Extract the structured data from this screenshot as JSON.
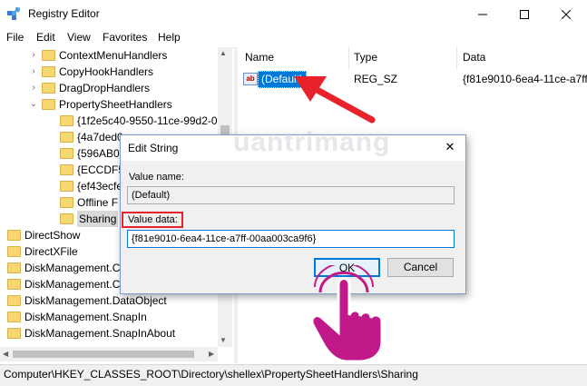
{
  "window": {
    "title": "Registry Editor",
    "minimize": "—",
    "maximize": "☐",
    "close": "✕"
  },
  "menu": [
    "File",
    "Edit",
    "View",
    "Favorites",
    "Help"
  ],
  "tree": {
    "items": [
      {
        "label": "ContextMenuHandlers",
        "expander": "›"
      },
      {
        "label": "CopyHookHandlers",
        "expander": "›"
      },
      {
        "label": "DragDropHandlers",
        "expander": "›"
      },
      {
        "label": "PropertySheetHandlers",
        "expander": "⌄"
      },
      {
        "label": "{1f2e5c40-9550-11ce-99d2-00"
      },
      {
        "label": "{4a7ded0"
      },
      {
        "label": "{596AB06"
      },
      {
        "label": "{ECCDF5"
      },
      {
        "label": "{ef43ecfe"
      },
      {
        "label": "Offline F"
      },
      {
        "label": "Sharing"
      },
      {
        "label": "DirectShow",
        "expander": "›"
      },
      {
        "label": "DirectXFile",
        "expander": "›"
      },
      {
        "label": "DiskManagement.C",
        "expander": "›"
      },
      {
        "label": "DiskManagement.C",
        "expander": "›"
      },
      {
        "label": "DiskManagement.DataObject",
        "expander": "›"
      },
      {
        "label": "DiskManagement.SnapIn",
        "expander": "›"
      },
      {
        "label": "DiskManagement.SnapInAbout",
        "expander": "›"
      }
    ]
  },
  "list": {
    "columns": [
      "Name",
      "Type",
      "Data"
    ],
    "rows": [
      {
        "icon": "ab",
        "name": "(Default)",
        "type": "REG_SZ",
        "data": "{f81e9010-6ea4-11ce-a7ff"
      }
    ]
  },
  "dialog": {
    "title": "Edit String",
    "close": "✕",
    "value_name_label": "Value name:",
    "value_name": "(Default)",
    "value_data_label": "Value data:",
    "value_data": "{f81e9010-6ea4-11ce-a7ff-00aa003ca9f6}",
    "ok": "OK",
    "cancel": "Cancel"
  },
  "watermark": "uantrimang",
  "status": "Computer\\HKEY_CLASSES_ROOT\\Directory\\shellex\\PropertySheetHandlers\\Sharing",
  "colors": {
    "selection": "#0078d7",
    "annotation": "#e8212b",
    "hand": "#c2198a"
  }
}
